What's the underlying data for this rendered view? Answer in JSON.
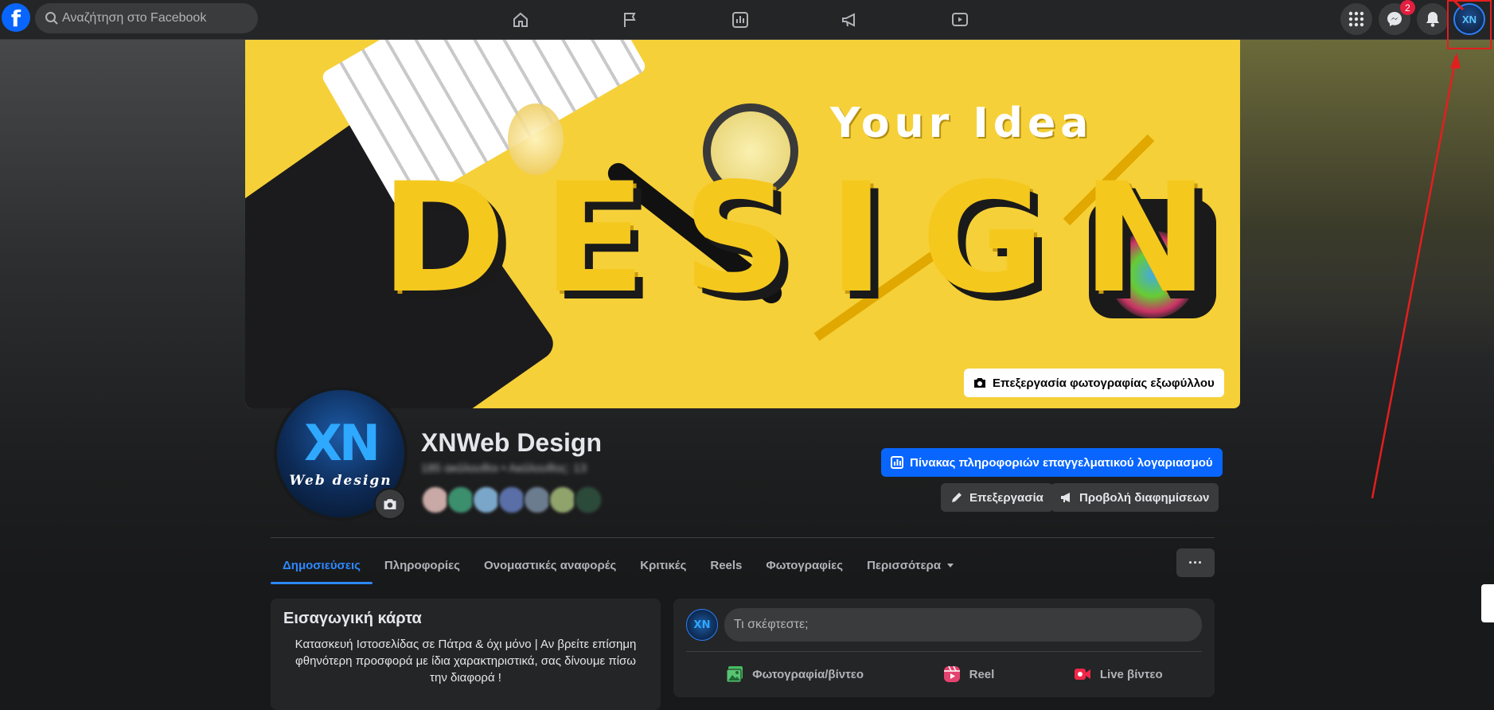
{
  "topbar": {
    "logo": "f",
    "search_placeholder": "Αναζήτηση στο Facebook",
    "nav_icons": [
      "home-icon",
      "flag-icon",
      "insights-icon",
      "megaphone-icon",
      "video-icon"
    ],
    "right_icons": [
      "menu-grid-icon",
      "messenger-icon",
      "bell-icon"
    ],
    "messenger_badge": "2"
  },
  "cover": {
    "headline": "Your Idea",
    "word": "DESIGN",
    "edit_button": "Επεξεργασία φωτογραφίας εξωφύλλου"
  },
  "profile": {
    "logo_mark": "XN",
    "logo_sub": "Web design",
    "name": "XNWeb Design",
    "stats": "185 ακόλουθοι • Ακόλουθος: 13"
  },
  "actions": {
    "dashboard": "Πίνακας πληροφοριών επαγγελματικού λογαριασμού",
    "edit": "Επεξεργασία",
    "ads": "Προβολή διαφημίσεων"
  },
  "tabs": [
    "Δημοσιεύσεις",
    "Πληροφορίες",
    "Ονομαστικές αναφορές",
    "Κριτικές",
    "Reels",
    "Φωτογραφίες",
    "Περισσότερα"
  ],
  "more_label": "···",
  "intro": {
    "title": "Εισαγωγική κάρτα",
    "text": "Κατασκευή Ιστοσελίδας σε Πάτρα & όχι μόνο | Αν βρείτε επίσημη φθηνότερη προσφορά με ίδια χαρακτηριστικά, σας δίνουμε πίσω την διαφορά !"
  },
  "composer": {
    "placeholder": "Τι σκέφτεστε;",
    "photo_video": "Φωτογραφία/βίντεο",
    "reel": "Reel",
    "live": "Live βίντεο"
  },
  "colors": {
    "accent": "#0866ff",
    "background": "#18191a",
    "card": "#242526",
    "annotation": "#e41e1e"
  }
}
